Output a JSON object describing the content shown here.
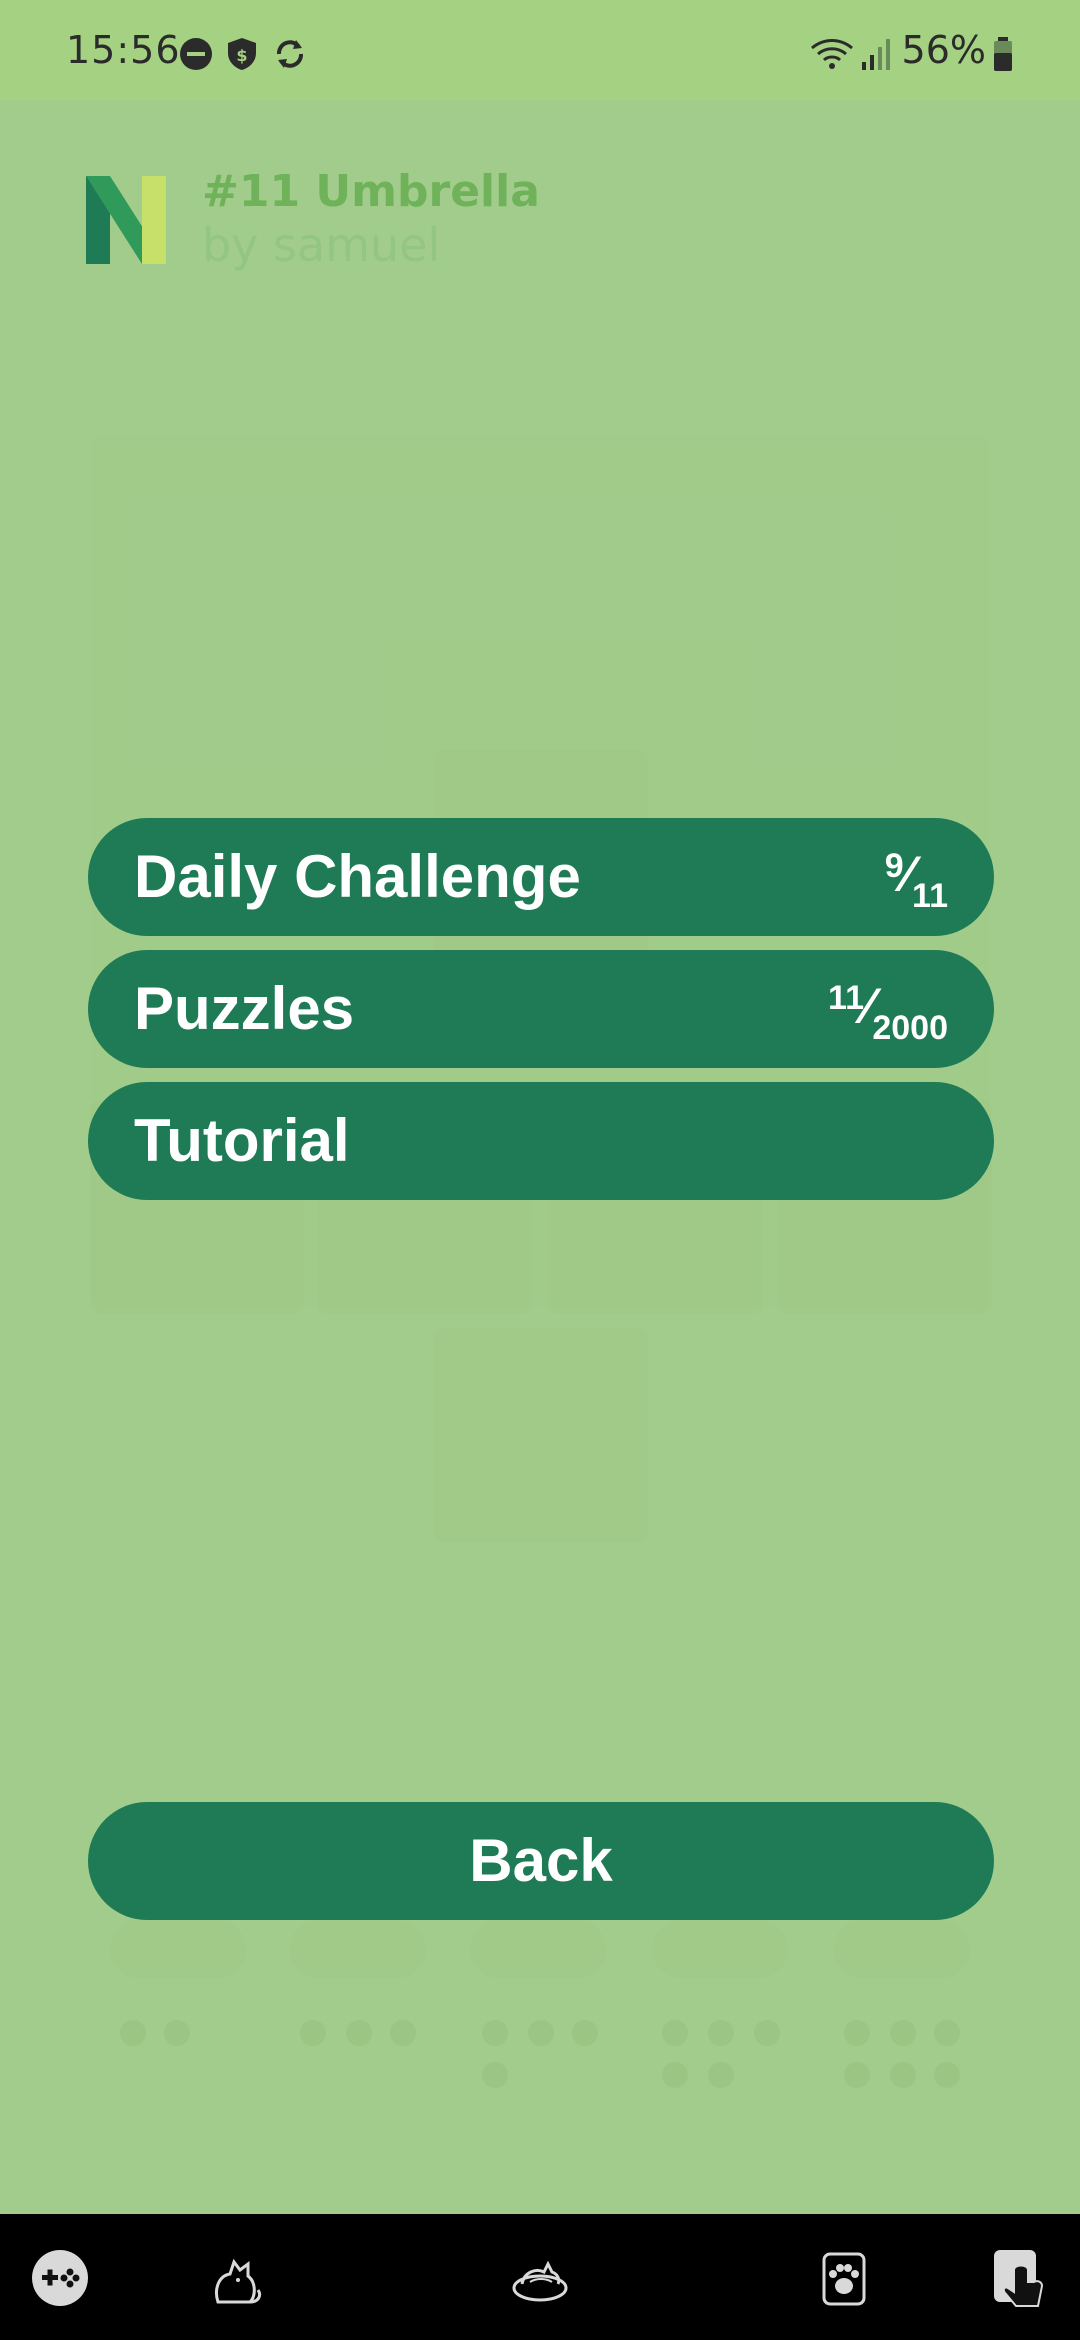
{
  "status_bar": {
    "time": "15:56",
    "battery": "56%",
    "icons": [
      "do-not-disturb-icon",
      "shield-icon",
      "sync-icon",
      "wifi-icon",
      "signal-icon",
      "battery-icon"
    ]
  },
  "header": {
    "title": "#11 Umbrella",
    "subtitle": "by samuel"
  },
  "menu": {
    "daily_challenge": {
      "label": "Daily Challenge",
      "progress_num": "9",
      "progress_den": "11"
    },
    "puzzles": {
      "label": "Puzzles",
      "progress_num": "11",
      "progress_den": "2000"
    },
    "tutorial": {
      "label": "Tutorial"
    },
    "back": {
      "label": "Back"
    }
  },
  "taskbar": {
    "icons": [
      "gamepad-icon",
      "cat-icon",
      "cat-bed-icon",
      "paw-icon",
      "touch-app-icon"
    ]
  },
  "colors": {
    "background": "#a2cc8b",
    "button": "#1e7b55",
    "button_text": "#ffffff",
    "title_accent": "#6fb25a"
  }
}
